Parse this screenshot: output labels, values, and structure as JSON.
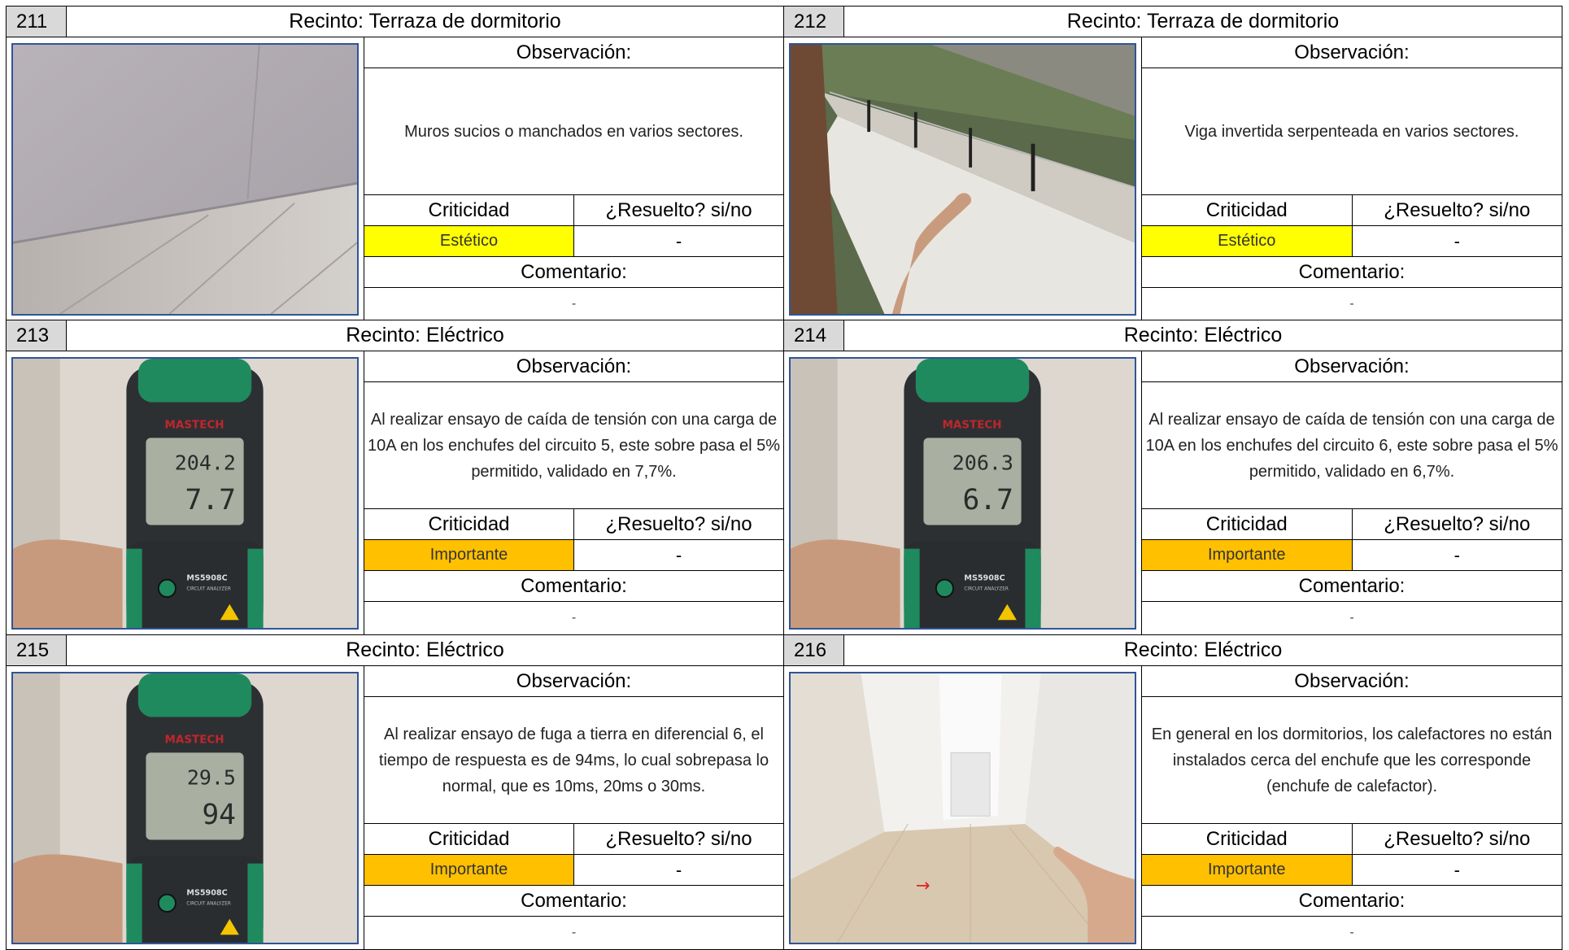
{
  "cards": [
    {
      "number": "211",
      "title": "Recinto: Terraza de dormitorio",
      "photo": "wall-photo",
      "observation_label": "Observación:",
      "observation": "Muros sucios o manchados en varios sectores.",
      "criticidad_label": "Criticidad",
      "resuelto_label": "¿Resuelto? si/no",
      "criticidad": "Estético",
      "criticidad_color": "#ffff00",
      "resuelto": "-",
      "comentario_label": "Comentario:",
      "comentario": "-"
    },
    {
      "number": "212",
      "title": "Recinto: Terraza de dormitorio",
      "photo": "terrace-photo",
      "observation_label": "Observación:",
      "observation": "Viga invertida serpenteada en varios sectores.",
      "criticidad_label": "Criticidad",
      "resuelto_label": "¿Resuelto? si/no",
      "criticidad": "Estético",
      "criticidad_color": "#ffff00",
      "resuelto": "-",
      "comentario_label": "Comentario:",
      "comentario": "-"
    },
    {
      "number": "213",
      "title": "Recinto: Eléctrico",
      "photo": "meter-photo",
      "observation_label": "Observación:",
      "observation": "Al realizar ensayo de caída de tensión con una carga de 10A en los enchufes del circuito 5, este sobre pasa el 5% permitido, validado en 7,7%.",
      "criticidad_label": "Criticidad",
      "resuelto_label": "¿Resuelto? si/no",
      "criticidad": "Importante",
      "criticidad_color": "#ffc000",
      "resuelto": "-",
      "comentario_label": "Comentario:",
      "comentario": "-",
      "meter": {
        "brand": "MASTECH",
        "reading_top": "204.2",
        "reading_main": "7.7",
        "model": "MS5908C",
        "model_sub": "CIRCUIT ANALYZER"
      }
    },
    {
      "number": "214",
      "title": "Recinto: Eléctrico",
      "photo": "meter-photo",
      "observation_label": "Observación:",
      "observation": "Al realizar ensayo de caída de tensión con una carga de 10A en los enchufes del circuito 6, este sobre pasa el 5% permitido, validado en 6,7%.",
      "criticidad_label": "Criticidad",
      "resuelto_label": "¿Resuelto? si/no",
      "criticidad": "Importante",
      "criticidad_color": "#ffc000",
      "resuelto": "-",
      "comentario_label": "Comentario:",
      "comentario": "-",
      "meter": {
        "brand": "MASTECH",
        "reading_top": "206.3",
        "reading_main": "6.7",
        "model": "MS5908C",
        "model_sub": "CIRCUIT ANALYZER"
      }
    },
    {
      "number": "215",
      "title": "Recinto: Eléctrico",
      "photo": "meter-photo",
      "observation_label": "Observación:",
      "observation": "Al realizar ensayo de fuga a tierra en diferencial 6, el tiempo de respuesta es de 94ms, lo cual sobrepasa lo normal, que es 10ms, 20ms o 30ms.",
      "criticidad_label": "Criticidad",
      "resuelto_label": "¿Resuelto? si/no",
      "criticidad": "Importante",
      "criticidad_color": "#ffc000",
      "resuelto": "-",
      "comentario_label": "Comentario:",
      "comentario": "-",
      "meter": {
        "brand": "MASTECH",
        "reading_top": "29.5",
        "reading_main": "94",
        "model": "MS5908C",
        "model_sub": "CIRCUIT ANALYZER"
      }
    },
    {
      "number": "216",
      "title": "Recinto: Eléctrico",
      "photo": "bedroom-photo",
      "observation_label": "Observación:",
      "observation": "En general en los dormitorios, los calefactores no están instalados cerca del enchufe que les corresponde (enchufe de calefactor).",
      "criticidad_label": "Criticidad",
      "resuelto_label": "¿Resuelto? si/no",
      "criticidad": "Importante",
      "criticidad_color": "#ffc000",
      "resuelto": "-",
      "comentario_label": "Comentario:",
      "comentario": "-"
    }
  ]
}
